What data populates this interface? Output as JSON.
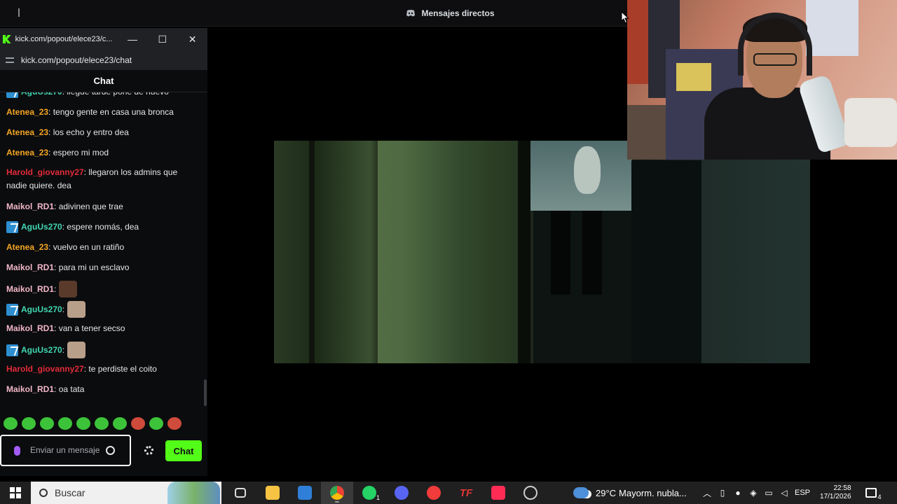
{
  "discord": {
    "title": "Mensajes directos"
  },
  "popout": {
    "title": "kick.com/popout/elece23/c...",
    "url": "kick.com/popout/elece23/chat",
    "chat_header": "Chat",
    "minimize": "—",
    "maximize": "☐",
    "close": "✕"
  },
  "chat": {
    "messages": [
      {
        "user": "AguUs270",
        "color": "#41d7b1",
        "badge": true,
        "text": ": llegue tarde pone de nuevo"
      },
      {
        "user": "Atenea_23",
        "color": "#f5a623",
        "badge": false,
        "text": ": tengo gente en casa una bronca"
      },
      {
        "user": "Atenea_23",
        "color": "#f5a623",
        "badge": false,
        "text": ": los echo y entro dea"
      },
      {
        "user": "Atenea_23",
        "color": "#f5a623",
        "badge": false,
        "text": ": espero mi mod"
      },
      {
        "user": "Harold_giovanny27",
        "color": "#e32b39",
        "badge": false,
        "text": ": llegaron los admins que nadie quiere. dea"
      },
      {
        "user": "Maikol_RD1",
        "color": "#f2b7c8",
        "badge": false,
        "text": ": adivinen que trae"
      },
      {
        "user": "AguUs270",
        "color": "#41d7b1",
        "badge": true,
        "text": ": espere nomás, dea"
      },
      {
        "user": "Atenea_23",
        "color": "#f5a623",
        "badge": false,
        "text": ": vuelvo en un ratiño"
      },
      {
        "user": "Maikol_RD1",
        "color": "#f2b7c8",
        "badge": false,
        "text": ": para mi un esclavo"
      },
      {
        "user": "Maikol_RD1",
        "color": "#f2b7c8",
        "badge": false,
        "text": ":"
      },
      {
        "user": "AguUs270",
        "color": "#41d7b1",
        "badge": true,
        "text": ":"
      },
      {
        "user": "Maikol_RD1",
        "color": "#f2b7c8",
        "badge": false,
        "text": ": van a tener secso"
      },
      {
        "user": "AguUs270",
        "color": "#41d7b1",
        "badge": true,
        "text": ":"
      },
      {
        "user": "Harold_giovanny27",
        "color": "#e32b39",
        "badge": false,
        "text": ": te perdiste el coito"
      },
      {
        "user": "Maikol_RD1",
        "color": "#f2b7c8",
        "badge": false,
        "text": ": oa tata"
      }
    ],
    "input_placeholder": "Enviar un mensaje",
    "send_label": "Chat",
    "accent": "#53fc18"
  },
  "taskbar": {
    "search_placeholder": "Buscar",
    "weather_temp": "29°C",
    "weather_text": "Mayorm. nubla...",
    "language": "ESP",
    "time": "22:58",
    "date": "17/1/2026",
    "whatsapp_badge": "1",
    "notifications_badge": "4"
  }
}
